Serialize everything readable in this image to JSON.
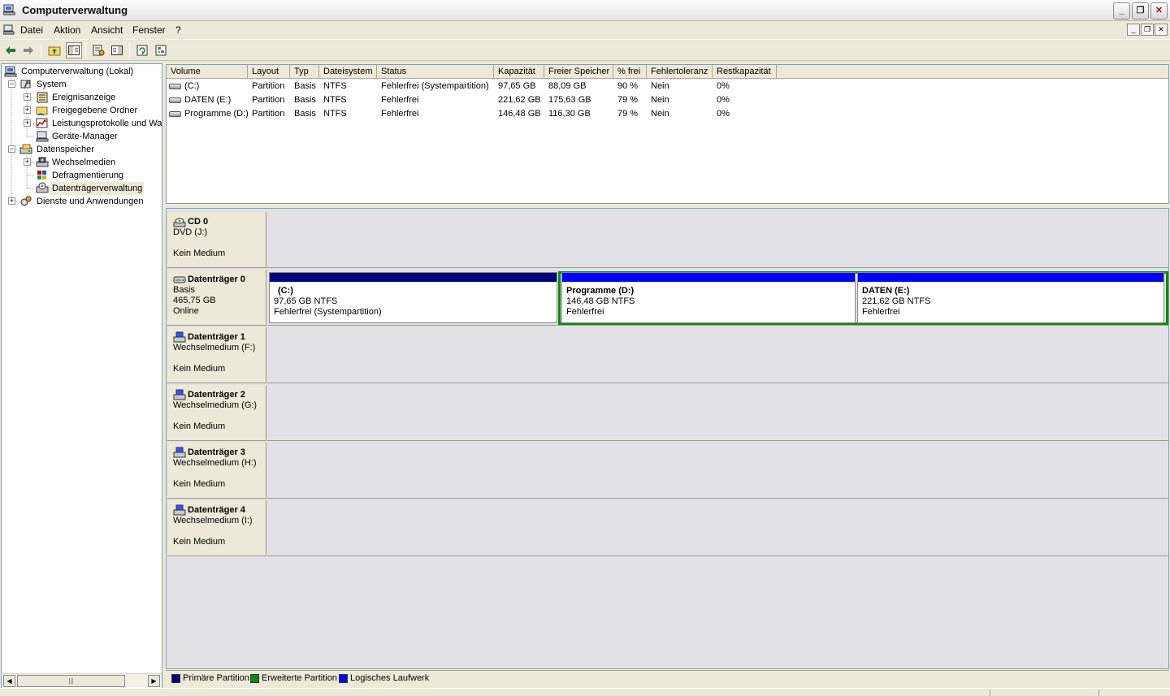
{
  "window": {
    "title": "Computerverwaltung",
    "min": "_",
    "max": "❐",
    "close": "✕"
  },
  "menu": {
    "items": [
      "Datei",
      "Aktion",
      "Ansicht",
      "Fenster",
      "?"
    ],
    "mdi_min": "_",
    "mdi_max": "❐",
    "mdi_close": "✕"
  },
  "tree": {
    "items": [
      {
        "label": "Computerverwaltung (Lokal)",
        "icon": "computer-icon"
      },
      {
        "label": "System",
        "icon": "tools-icon",
        "expander": "−"
      },
      {
        "label": "Ereignisanzeige",
        "icon": "event-viewer-icon",
        "expander": "+"
      },
      {
        "label": "Freigegebene Ordner",
        "icon": "shared-folder-icon",
        "expander": "+"
      },
      {
        "label": "Leistungsprotokolle und War",
        "icon": "performance-icon",
        "expander": "+"
      },
      {
        "label": "Geräte-Manager",
        "icon": "device-manager-icon"
      },
      {
        "label": "Datenspeicher",
        "icon": "storage-icon",
        "expander": "−"
      },
      {
        "label": "Wechselmedien",
        "icon": "removable-media-icon",
        "expander": "+"
      },
      {
        "label": "Defragmentierung",
        "icon": "defrag-icon"
      },
      {
        "label": "Datenträgerverwaltung",
        "icon": "disk-management-icon"
      },
      {
        "label": "Dienste und Anwendungen",
        "icon": "services-icon",
        "expander": "+"
      }
    ]
  },
  "volumes": {
    "headers": [
      "Volume",
      "Layout",
      "Typ",
      "Dateisystem",
      "Status",
      "Kapazität",
      "Freier Speicher",
      "% frei",
      "Fehlertoleranz",
      "Restkapazität"
    ],
    "rows": [
      [
        "(C:)",
        "Partition",
        "Basis",
        "NTFS",
        "Fehlerfrei (Systempartition)",
        "97,65 GB",
        "88,09 GB",
        "90 %",
        "Nein",
        "0%"
      ],
      [
        "DATEN (E:)",
        "Partition",
        "Basis",
        "NTFS",
        "Fehlerfrei",
        "221,62 GB",
        "175,63 GB",
        "79 %",
        "Nein",
        "0%"
      ],
      [
        "Programme (D:)",
        "Partition",
        "Basis",
        "NTFS",
        "Fehlerfrei",
        "146,48 GB",
        "116,30 GB",
        "79 %",
        "Nein",
        "0%"
      ]
    ]
  },
  "disks": [
    {
      "name": "CD 0",
      "line1": "DVD (J:)",
      "line2": "",
      "line3": "Kein Medium",
      "icon": "cd-icon"
    },
    {
      "name": "Datenträger 0",
      "line1": "Basis",
      "line2": "465,75 GB",
      "line3": "Online",
      "icon": "hard-disk-icon"
    },
    {
      "name": "Datenträger 1",
      "line1": "Wechselmedium (F:)",
      "line2": "",
      "line3": "Kein Medium",
      "icon": "removable-disk-icon"
    },
    {
      "name": "Datenträger 2",
      "line1": "Wechselmedium (G:)",
      "line2": "",
      "line3": "Kein Medium",
      "icon": "removable-disk-icon"
    },
    {
      "name": "Datenträger 3",
      "line1": "Wechselmedium (H:)",
      "line2": "",
      "line3": "Kein Medium",
      "icon": "removable-disk-icon"
    },
    {
      "name": "Datenträger 4",
      "line1": "Wechselmedium (I:)",
      "line2": "",
      "line3": "Kein Medium",
      "icon": "removable-disk-icon"
    }
  ],
  "partitions": [
    {
      "name": "(C:)",
      "size": "97,65 GB NTFS",
      "status": "Fehlerfrei (Systempartition)",
      "color": "#000080"
    },
    {
      "name": "Programme  (D:)",
      "size": "146,48 GB NTFS",
      "status": "Fehlerfrei",
      "color": "#0000ff"
    },
    {
      "name": "DATEN  (E:)",
      "size": "221,62 GB NTFS",
      "status": "Fehlerfrei",
      "color": "#0000ff"
    }
  ],
  "legend": [
    {
      "label": "Primäre Partition",
      "color": "#000080"
    },
    {
      "label": "Erweiterte Partition",
      "color": "#0e8a0e"
    },
    {
      "label": "Logisches Laufwerk",
      "color": "#0000ff"
    }
  ]
}
